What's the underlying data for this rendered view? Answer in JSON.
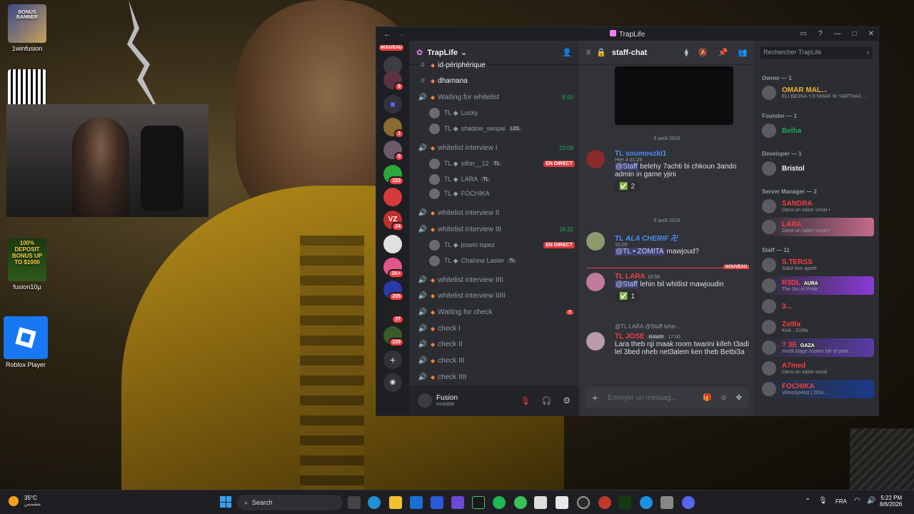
{
  "desktop": {
    "icons": [
      {
        "label": "1winfusion"
      },
      {
        "label": ""
      },
      {
        "label": "fusion10µ"
      },
      {
        "label": "Roblox Player"
      }
    ],
    "banner_text": "BONUS BANNER",
    "promo_text": "100% DEPOSIT BONUS UP TO $1000"
  },
  "window": {
    "title": "TrapLife"
  },
  "guilds": {
    "nouveau": "NOUVEAU",
    "badges": [
      "9",
      "1",
      "9",
      "223",
      "24",
      "1K+",
      "205",
      "37",
      "229"
    ]
  },
  "channels": {
    "server_name": "TrapLife",
    "items": [
      {
        "type": "text",
        "name": "id-périphérique"
      },
      {
        "type": "text",
        "name": "dhamana"
      },
      {
        "type": "voice",
        "name": "Waiting for whitelist",
        "time": "8:50"
      },
      {
        "type": "user",
        "name": "Lucky",
        "tag": ""
      },
      {
        "type": "user",
        "name": "shadow_senpai",
        "tag": "LOL"
      },
      {
        "type": "voice",
        "name": "whitelist interview I",
        "time": "23:08"
      },
      {
        "type": "user",
        "name": "sifon__12",
        "tag": "TL",
        "live": "EN DIRECT"
      },
      {
        "type": "user",
        "name": "LARA",
        "tag": "TL"
      },
      {
        "type": "user",
        "name": "FOCHIKA",
        "tag": ""
      },
      {
        "type": "voice",
        "name": "whitelist interview II"
      },
      {
        "type": "voice",
        "name": "whitelist interview III",
        "time": "16:32"
      },
      {
        "type": "user",
        "name": "joselo lopez",
        "tag": "",
        "live": "EN DIRECT"
      },
      {
        "type": "user",
        "name": "Chahine Lasler",
        "tag": "TL"
      },
      {
        "type": "voice",
        "name": "whitelist interview IIII"
      },
      {
        "type": "voice",
        "name": "whitelist interview IIIII"
      },
      {
        "type": "voice",
        "name": "Waiting for check",
        "badge": "8"
      },
      {
        "type": "voice",
        "name": "check I"
      },
      {
        "type": "voice",
        "name": "check II"
      },
      {
        "type": "voice",
        "name": "check III"
      },
      {
        "type": "voice",
        "name": "check IIII"
      }
    ]
  },
  "user": {
    "name": "Fusion",
    "status": "Invisible"
  },
  "chat": {
    "channel": "staff-chat",
    "search_placeholder": "Rechercher TrapLife",
    "composer_placeholder": "Envoyer un messag...",
    "dates": [
      "5 août 2026",
      "6 août 2026"
    ],
    "new_label": "NOUVEAU",
    "messages": [
      {
        "prefix": "TL",
        "name": "soumoszki1",
        "time": "Hier à 01:29",
        "mention": "@Staff",
        "text": "belehy 7achti bi chkoun 3ando admin in game yjini",
        "reaction": "2"
      },
      {
        "prefix": "TL",
        "name": "ALA CHERIF 卍",
        "time": "10:09",
        "mention": "@TL • ZOMITA",
        "text": "mawjoud?"
      },
      {
        "prefix": "TL",
        "name": "LARA",
        "time": "16:58",
        "mention": "@Staff",
        "text": "lehin bil whitlist mawjoudin",
        "reaction": "1"
      },
      {
        "reply": "@TL LARA  @Staff lehin ...",
        "prefix": "TL",
        "name": "JOSE",
        "tag": "RAWR",
        "time": "17:06",
        "text": "Lara theb nji maak room twarini kifeh t3adi lel 3bed nheb net3alem ken theb Betbi3a"
      }
    ]
  },
  "members": {
    "groups": [
      {
        "role": "Owner — 1",
        "members": [
          {
            "name": "OMAR MAL...",
            "sub": "ELI BE3NA YJI NHAR W YARTHA3 ..."
          }
        ]
      },
      {
        "role": "Founder — 1",
        "members": [
          {
            "name": "Belha",
            "sub": ""
          }
        ]
      },
      {
        "role": "Developer — 1",
        "members": [
          {
            "name": "Bristol",
            "sub": ""
          }
        ]
      },
      {
        "role": "Server Manager — 2",
        "members": [
          {
            "name": "SANDRA",
            "sub": "Dans un salon vocal •"
          },
          {
            "name": "LARA",
            "sub": "Dans un salon vocal •"
          }
        ]
      },
      {
        "role": "Staff — 11",
        "members": [
          {
            "name": "S.TERSS",
            "sub": "Salut bon apetit"
          },
          {
            "name": "R3DL",
            "sub": "The Sin of Pride",
            "tag": "AURA"
          },
          {
            "name": "3...",
            "sub": ""
          },
          {
            "name": "Zo9la",
            "sub": "Kick : Zo9la"
          },
          {
            "name": "? 3E",
            "sub": "medli blage nsaker bih el pare...",
            "tag": "GAZA"
          },
          {
            "name": "A7med",
            "sub": "Dans un salon vocal"
          },
          {
            "name": "FOCHIKA",
            "sub": "VelocityHost | DDo..."
          }
        ]
      }
    ]
  },
  "taskbar": {
    "weather_temp": "35°C",
    "weather_sub": "مشمس",
    "search": "Search",
    "lang": "FRA",
    "time": "5:22 PM",
    "date": "8/6/2026"
  }
}
